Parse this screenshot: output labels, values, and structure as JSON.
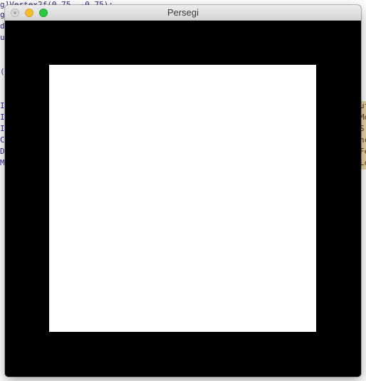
{
  "background_code": {
    "left_fragments": [
      "g]Vertex2f(0.75, -0.75);",
      "gl",
      "d",
      "us",
      "",
      "",
      "(i",
      "",
      "",
      "In",
      "In",
      "In",
      "Cr",
      "Di",
      "Ma"
    ],
    "right_fragments": [
      "ut",
      "Mo",
      "S",
      "nc",
      "Fe",
      "Lo"
    ],
    "code_color": "#3b2a8a",
    "highlight_color": "#e9d6a3"
  },
  "window": {
    "title": "Persegi",
    "canvas_color": "#000000",
    "square_color": "#ffffff",
    "controls": {
      "close_color": "#d9d9d9",
      "minimize_color": "#f5bd2f",
      "zoom_color": "#2bc840"
    }
  }
}
